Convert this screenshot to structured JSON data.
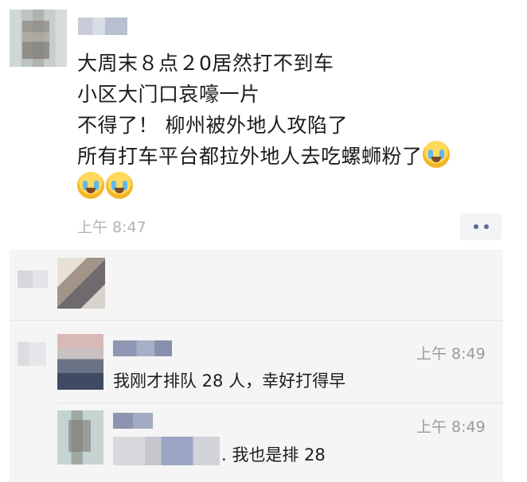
{
  "post": {
    "lines": [
      "大周末８点２0居然打不到车",
      "小区大门口哀嚎一片",
      "不得了！ 柳州被外地人攻陷了",
      "所有打车平台都拉外地人去吃螺蛳粉了"
    ],
    "emoji_name": "loudly-crying-face",
    "time": "上午 8:47"
  },
  "comments": [
    {
      "time": "上午 8:49",
      "text": "我刚才排队 28 人，幸好打得早"
    },
    {
      "time": "上午 8:49",
      "text": ". 我也是排 28"
    }
  ],
  "icons": {
    "more": "more-dots-icon",
    "like": "like-icon",
    "comment": "comment-icon"
  },
  "colors": {
    "link_name": "#5a6c95",
    "timestamp": "#b3b3b3",
    "comment_bg": "#f5f5f5"
  }
}
